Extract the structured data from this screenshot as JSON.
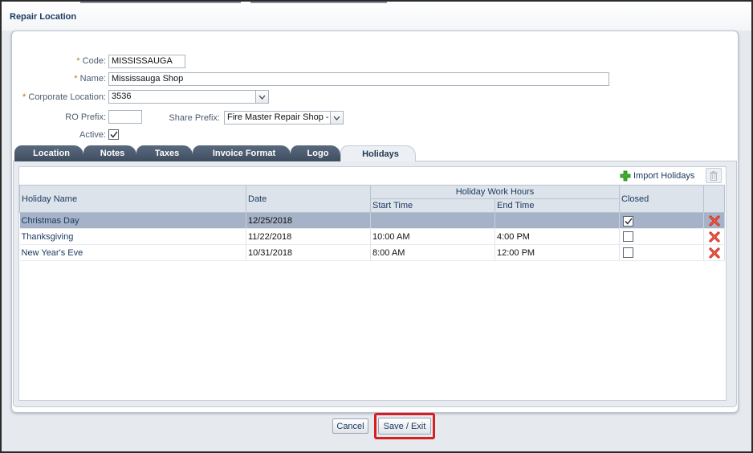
{
  "dialog": {
    "title": "Repair Location"
  },
  "form": {
    "code_label": "Code:",
    "code_value": "MISSISSAUGA",
    "name_label": "Name:",
    "name_value": "Mississauga Shop",
    "corporate_label": "Corporate Location:",
    "corporate_value": "3536",
    "ro_prefix_label": "RO Prefix:",
    "ro_prefix_value": "",
    "share_prefix_label": "Share Prefix:",
    "share_prefix_value": "Fire Master Repair Shop -",
    "active_label": "Active:",
    "active_checked": true,
    "required_marker": "*"
  },
  "tabs": [
    {
      "label": "Location"
    },
    {
      "label": "Notes"
    },
    {
      "label": "Taxes"
    },
    {
      "label": "Invoice Format"
    },
    {
      "label": "Logo"
    },
    {
      "label": "Holidays",
      "active": true
    }
  ],
  "toolbar": {
    "import_label": "Import Holidays",
    "import_icon": "plus-icon",
    "delete_icon": "trash-icon"
  },
  "table": {
    "headers": {
      "holiday_name": "Holiday Name",
      "date": "Date",
      "work_hours_group": "Holiday Work Hours",
      "start_time": "Start Time",
      "end_time": "End Time",
      "closed": "Closed"
    },
    "rows": [
      {
        "name": "Christmas Day",
        "date": "12/25/2018",
        "start": "",
        "end": "",
        "closed": true,
        "selected": true
      },
      {
        "name": "Thanksgiving",
        "date": "11/22/2018",
        "start": "10:00 AM",
        "end": "4:00 PM",
        "closed": false,
        "selected": false
      },
      {
        "name": "New Year's Eve",
        "date": "10/31/2018",
        "start": "8:00 AM",
        "end": "12:00 PM",
        "closed": false,
        "selected": false
      }
    ]
  },
  "buttons": {
    "cancel_label": "Cancel",
    "save_exit_label": "Save / Exit"
  },
  "colors": {
    "accent_red": "#d81e1e",
    "tab_dark": "#4a586b",
    "selected_row": "#a6b2c8",
    "title_navy": "#1c3b62",
    "required": "#b47a13"
  }
}
